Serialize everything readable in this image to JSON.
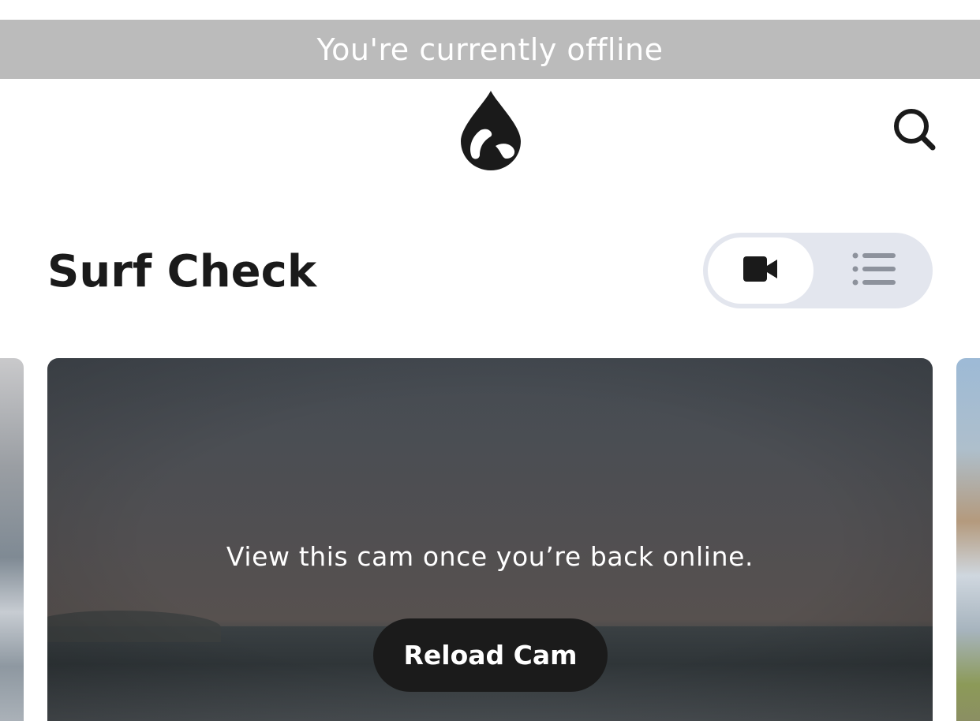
{
  "offline_banner": {
    "text": "You're currently offline"
  },
  "header": {
    "logo_icon": "water-drop-logo-icon",
    "search_icon": "search-icon"
  },
  "page": {
    "title": "Surf Check"
  },
  "view_toggle": {
    "selected": "cam",
    "options": [
      {
        "id": "cam",
        "icon": "video-camera-icon"
      },
      {
        "id": "list",
        "icon": "list-icon"
      }
    ]
  },
  "cam_card": {
    "message": "View this cam once you’re back online.",
    "reload_label": "Reload Cam"
  },
  "colors": {
    "banner_bg": "#bbbbbb",
    "text_dark": "#1a1a1a",
    "toggle_bg": "#e3e6ee",
    "button_dark": "#1b1b1b"
  }
}
